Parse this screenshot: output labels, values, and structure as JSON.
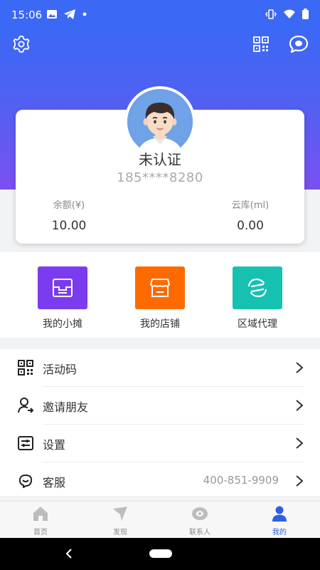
{
  "status_bar": {
    "time": "15:06"
  },
  "profile": {
    "name": "未认证",
    "phone": "185****8280"
  },
  "stats": [
    {
      "label": "余额(¥)",
      "value": "10.00"
    },
    {
      "label": "云库(ml)",
      "value": "0.00"
    }
  ],
  "shortcuts": [
    {
      "label": "我的小摊",
      "color": "#7b3bf0",
      "icon": "stall-icon"
    },
    {
      "label": "我的店铺",
      "color": "#ff6a00",
      "icon": "store-icon"
    },
    {
      "label": "区域代理",
      "color": "#17c1b2",
      "icon": "region-agent-icon"
    }
  ],
  "menu": [
    {
      "label": "活动码",
      "value": "",
      "icon": "qr-code-icon"
    },
    {
      "label": "邀请朋友",
      "value": "",
      "icon": "invite-user-icon"
    },
    {
      "label": "设置",
      "value": "",
      "icon": "settings-sliders-icon"
    },
    {
      "label": "客服",
      "value": "400-851-9909",
      "icon": "customer-service-icon"
    }
  ],
  "tabs": [
    {
      "label": "首页",
      "icon": "home-icon",
      "active": false
    },
    {
      "label": "发现",
      "icon": "discover-icon",
      "active": false
    },
    {
      "label": "联系人",
      "icon": "contacts-icon",
      "active": false
    },
    {
      "label": "我的",
      "icon": "profile-icon",
      "active": true
    }
  ],
  "colors": {
    "primary": "#3b68f5",
    "gradient_end": "#7b4ff0",
    "active_tab": "#2f5de5"
  }
}
